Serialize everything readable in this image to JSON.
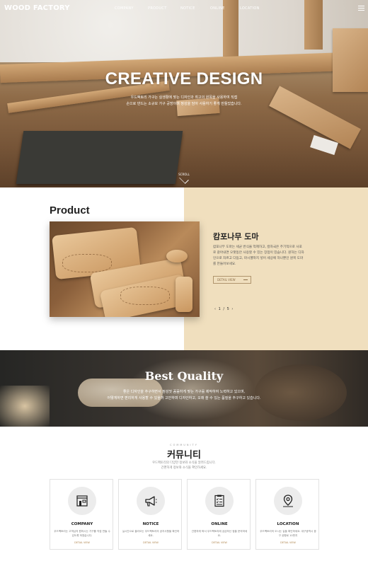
{
  "header": {
    "logo": "WOOD FACTORY",
    "menu": [
      "COMPANY",
      "PRODUCT",
      "NOTICE",
      "ONLINE",
      "LOCATION"
    ]
  },
  "hero": {
    "title": "CREATIVE DESIGN",
    "subtitle_lines": [
      "우드팩토리 가구는 실생활에 맞는 디자인과 최고의 원목을 사용하여 직접",
      "손으로 만드는 소규모 가구 공방이며 정성을 담아 사용하기 좋게 만들었습니다."
    ],
    "scroll_label": "SCROLL"
  },
  "product": {
    "section_title": "Product",
    "name": "캄포나무 도마",
    "description": "캄포나무 도마는 세균 번식을 억제하고, 칼자국은 주기적으로 사포로 갈아내면 오랫동안 사용할 수 있는 장점이 있습니다. 원하는 디자인으로 자르고 다듬고, 마시멜까지 넣어 세상에 하나뿐인 원목 도마를 만들어보세요.",
    "detail_label": "DETAIL VIEW",
    "pager": "‹ 1 / 5 ›"
  },
  "quality": {
    "title": "Best Quality",
    "desc_lines": [
      "좋은 디자인을 추구하면서 정성껏 꼼꼼하게 맞는 가구를 제작하여 노력하고 있으며,",
      "어떻게하면 편리하게 사용할 수 있을까 고민하며 디자인하고, 오래 쓸 수 있는 품질을 추구하고 있습니다."
    ]
  },
  "community": {
    "small_label": "COMMUNITY",
    "title": "커뮤니티",
    "desc_lines": [
      "우드팩토리의 다양한 정보와 소식을 알려드립니다.",
      "간편하게 정보와 소식을 확인하세요."
    ],
    "cards": [
      {
        "icon": "shop-icon",
        "title": "COMPANY",
        "desc": "우드팩토리는 고객님의 원하시는 가구를 직접 만들 수 있도록 하였습니다.",
        "link": "DETAIL VIEW"
      },
      {
        "icon": "megaphone-icon",
        "title": "NOTICE",
        "desc": "실시간으로 올라오는 우드팩토리의 공지사항을 확인하세요.",
        "link": "DETAIL VIEW"
      },
      {
        "icon": "checklist-icon",
        "title": "ONLINE",
        "desc": "간편하게 봐서 우드팩토리에 궁금하신 점을 문의하세요.",
        "link": "DETAIL VIEW"
      },
      {
        "icon": "map-pin-icon",
        "title": "LOCATION",
        "desc": "우드팩토리의 오시는 길을 확인하세요. 대구광역시 중구 공평로 10번지",
        "link": "DETAIL VIEW"
      }
    ]
  },
  "colors": {
    "beige": "#f0dfbe",
    "accent": "#b0864f"
  }
}
